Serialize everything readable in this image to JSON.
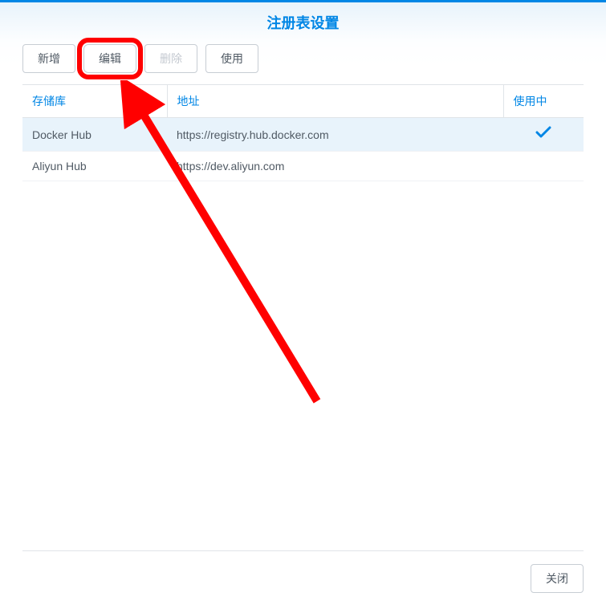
{
  "dialog": {
    "title": "注册表设置"
  },
  "toolbar": {
    "add_label": "新增",
    "edit_label": "编辑",
    "delete_label": "删除",
    "use_label": "使用"
  },
  "table": {
    "headers": {
      "repository": "存储库",
      "url": "地址",
      "in_use": "使用中"
    },
    "rows": [
      {
        "repository": "Docker Hub",
        "url": "https://registry.hub.docker.com",
        "in_use": true,
        "selected": true
      },
      {
        "repository": "Aliyun Hub",
        "url": "https://dev.aliyun.com",
        "in_use": false,
        "selected": false
      }
    ]
  },
  "footer": {
    "close_label": "关闭"
  },
  "annotation": {
    "highlight_button": "edit"
  }
}
